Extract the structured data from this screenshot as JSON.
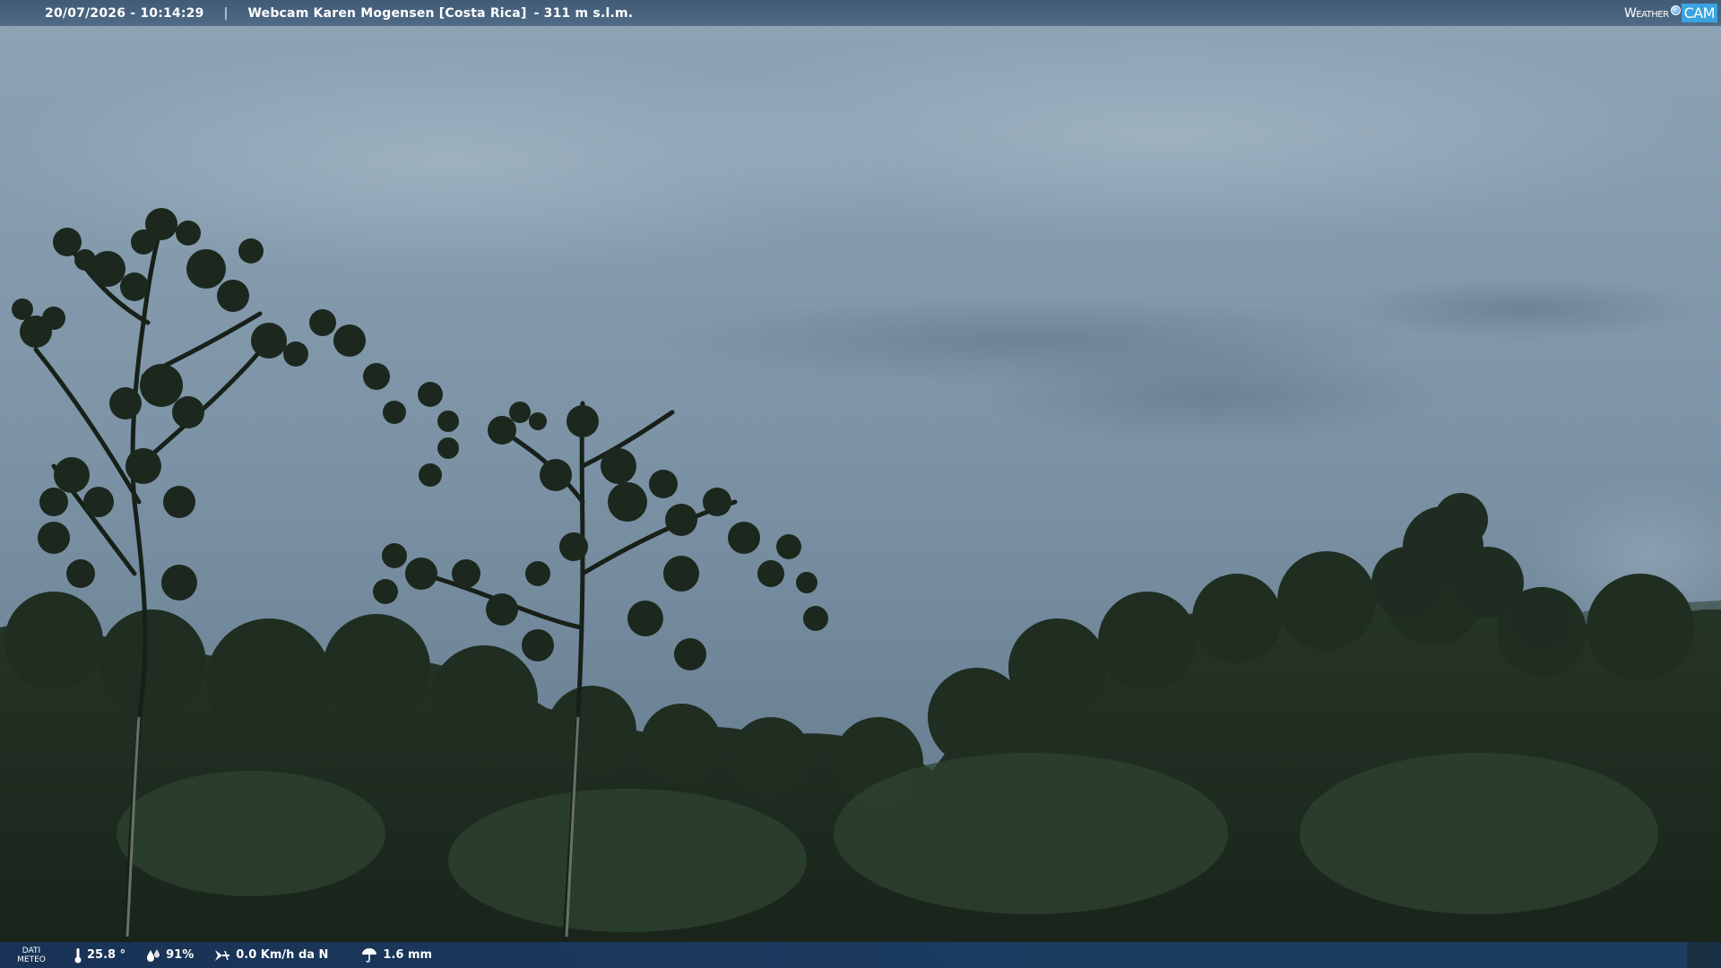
{
  "header": {
    "datetime": "20/07/2026 - 10:14:29",
    "separator": "|",
    "title": "Webcam Karen Mogensen [Costa Rica]",
    "altitude": "- 311 m s.l.m."
  },
  "logo": {
    "word1": "Weather",
    "word2": "CAM"
  },
  "weather": {
    "label_line1": "DATI",
    "label_line2": "METEO",
    "temperature": "25.8 °",
    "humidity": "91%",
    "wind": "0.0 Km/h da N",
    "rain": "1.6 mm"
  },
  "colors": {
    "sky_top": "#8fa6b8",
    "sky_bottom": "#6c8496",
    "vegetation": "#1f2d22",
    "header_bar": "#3f5c7c",
    "footer_bar": "#1c3a64"
  }
}
